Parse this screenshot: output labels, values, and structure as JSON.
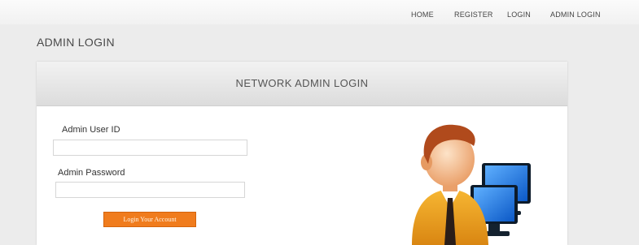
{
  "nav": {
    "items": [
      {
        "label": "HOME"
      },
      {
        "label": "REGISTER"
      },
      {
        "label": "LOGIN"
      },
      {
        "label": "ADMIN LOGIN"
      }
    ]
  },
  "page": {
    "title": "ADMIN LOGIN"
  },
  "panel": {
    "title": "NETWORK ADMIN LOGIN",
    "user_id_label": "Admin User ID",
    "user_id_value": "",
    "password_label": "Admin Password",
    "password_value": "",
    "login_button_label": "Login Your Account"
  },
  "colors": {
    "accent": "#f07c1d",
    "background": "#ececec"
  },
  "icons": [
    "admin-network-icon"
  ]
}
